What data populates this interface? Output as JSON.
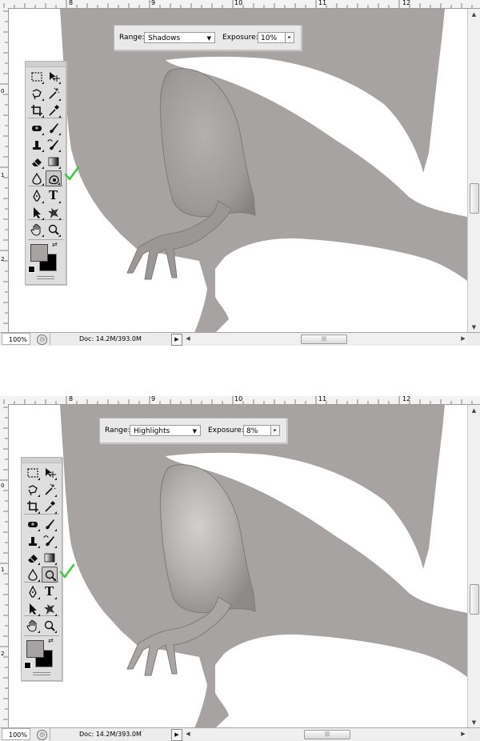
{
  "colors": {
    "creature": "#a7a3a2",
    "leg_highlight": "#c8c4c3",
    "leg_shadow": "#8b8787",
    "check_mark": "#3ec83e",
    "toolbox_bg": "#dedede"
  },
  "ruler": {
    "top_labels": [
      "8",
      "9",
      "10",
      "11",
      "12"
    ],
    "left_labels": [
      "0",
      "1",
      "2"
    ]
  },
  "panes": [
    {
      "options_bar": {
        "range_label": "Range:",
        "range_value": "Shadows",
        "exposure_label": "Exposure:",
        "exposure_value": "10%"
      },
      "active_tool": "burn-tool",
      "status": {
        "zoom": "100%",
        "doc": "Doc: 14.2M/393.0M"
      }
    },
    {
      "options_bar": {
        "range_label": "Range:",
        "range_value": "Highlights",
        "exposure_label": "Exposure:",
        "exposure_value": "8%"
      },
      "active_tool": "dodge-tool",
      "status": {
        "zoom": "100%",
        "doc": "Doc: 14.2M/393.0M"
      }
    }
  ],
  "toolbox": {
    "tools": [
      {
        "name": "marquee-tool",
        "icon": "dashed-rect"
      },
      {
        "name": "move-tool",
        "icon": "arrow-cross"
      },
      {
        "name": "lasso-tool",
        "icon": "lasso"
      },
      {
        "name": "magic-wand-tool",
        "icon": "wand"
      },
      {
        "name": "crop-tool",
        "icon": "crop"
      },
      {
        "name": "eyedropper-tool",
        "icon": "eyedropper"
      },
      {
        "name": "healing-brush-tool",
        "icon": "bandage"
      },
      {
        "name": "brush-tool",
        "icon": "brush"
      },
      {
        "name": "clone-stamp-tool",
        "icon": "stamp"
      },
      {
        "name": "history-brush-tool",
        "icon": "history-brush"
      },
      {
        "name": "eraser-tool",
        "icon": "eraser"
      },
      {
        "name": "gradient-tool",
        "icon": "gradient"
      },
      {
        "name": "blur-tool",
        "icon": "drop"
      },
      {
        "name": "dodge-burn-tool",
        "icon": "dodge-burn"
      },
      {
        "name": "pen-tool",
        "icon": "pen"
      },
      {
        "name": "type-tool",
        "icon": "type",
        "glyph": "T"
      },
      {
        "name": "path-selection-tool",
        "icon": "arrow"
      },
      {
        "name": "shape-tool",
        "icon": "blob"
      },
      {
        "name": "hand-tool",
        "icon": "hand"
      },
      {
        "name": "zoom-tool",
        "icon": "magnifier"
      }
    ],
    "foreground_color": "#a7a3a2",
    "background_color": "#000000"
  }
}
